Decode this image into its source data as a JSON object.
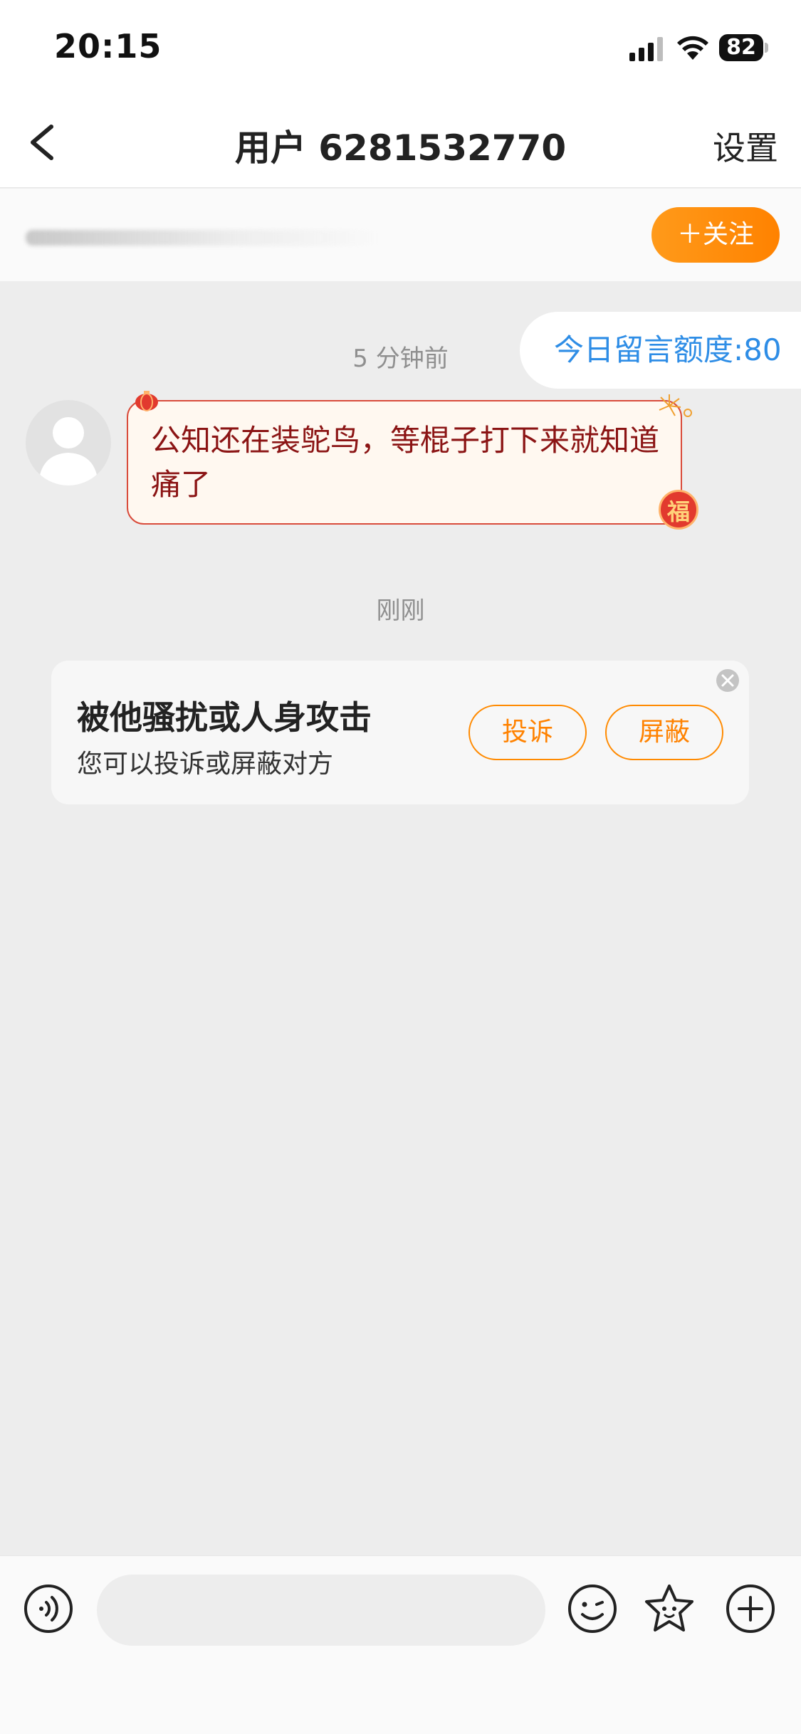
{
  "status_bar": {
    "time": "20:15",
    "battery": "82"
  },
  "nav": {
    "title": "用户 6281532770",
    "settings_label": "设置"
  },
  "follow_bar": {
    "follow_label": "＋关注"
  },
  "quota": {
    "label": "今日留言额度:80"
  },
  "messages": [
    {
      "timestamp": "5 分钟前",
      "text": "公知还在装鸵鸟，等棍子打下来就知道痛了",
      "badge": "福"
    }
  ],
  "notice": {
    "timestamp": "刚刚",
    "title": "被他骚扰或人身攻击",
    "subtitle": "您可以投诉或屏蔽对方",
    "complain_label": "投诉",
    "block_label": "屏蔽"
  },
  "colors": {
    "accent": "#ff8200",
    "quota_text": "#2e8de6",
    "bubble_text": "#8b1414",
    "bubble_border": "#d94b3b"
  },
  "icons": [
    "signal-icon",
    "wifi-icon",
    "battery-icon",
    "back-icon",
    "voice-icon",
    "emoji-icon",
    "sticker-icon",
    "plus-icon",
    "close-icon"
  ]
}
